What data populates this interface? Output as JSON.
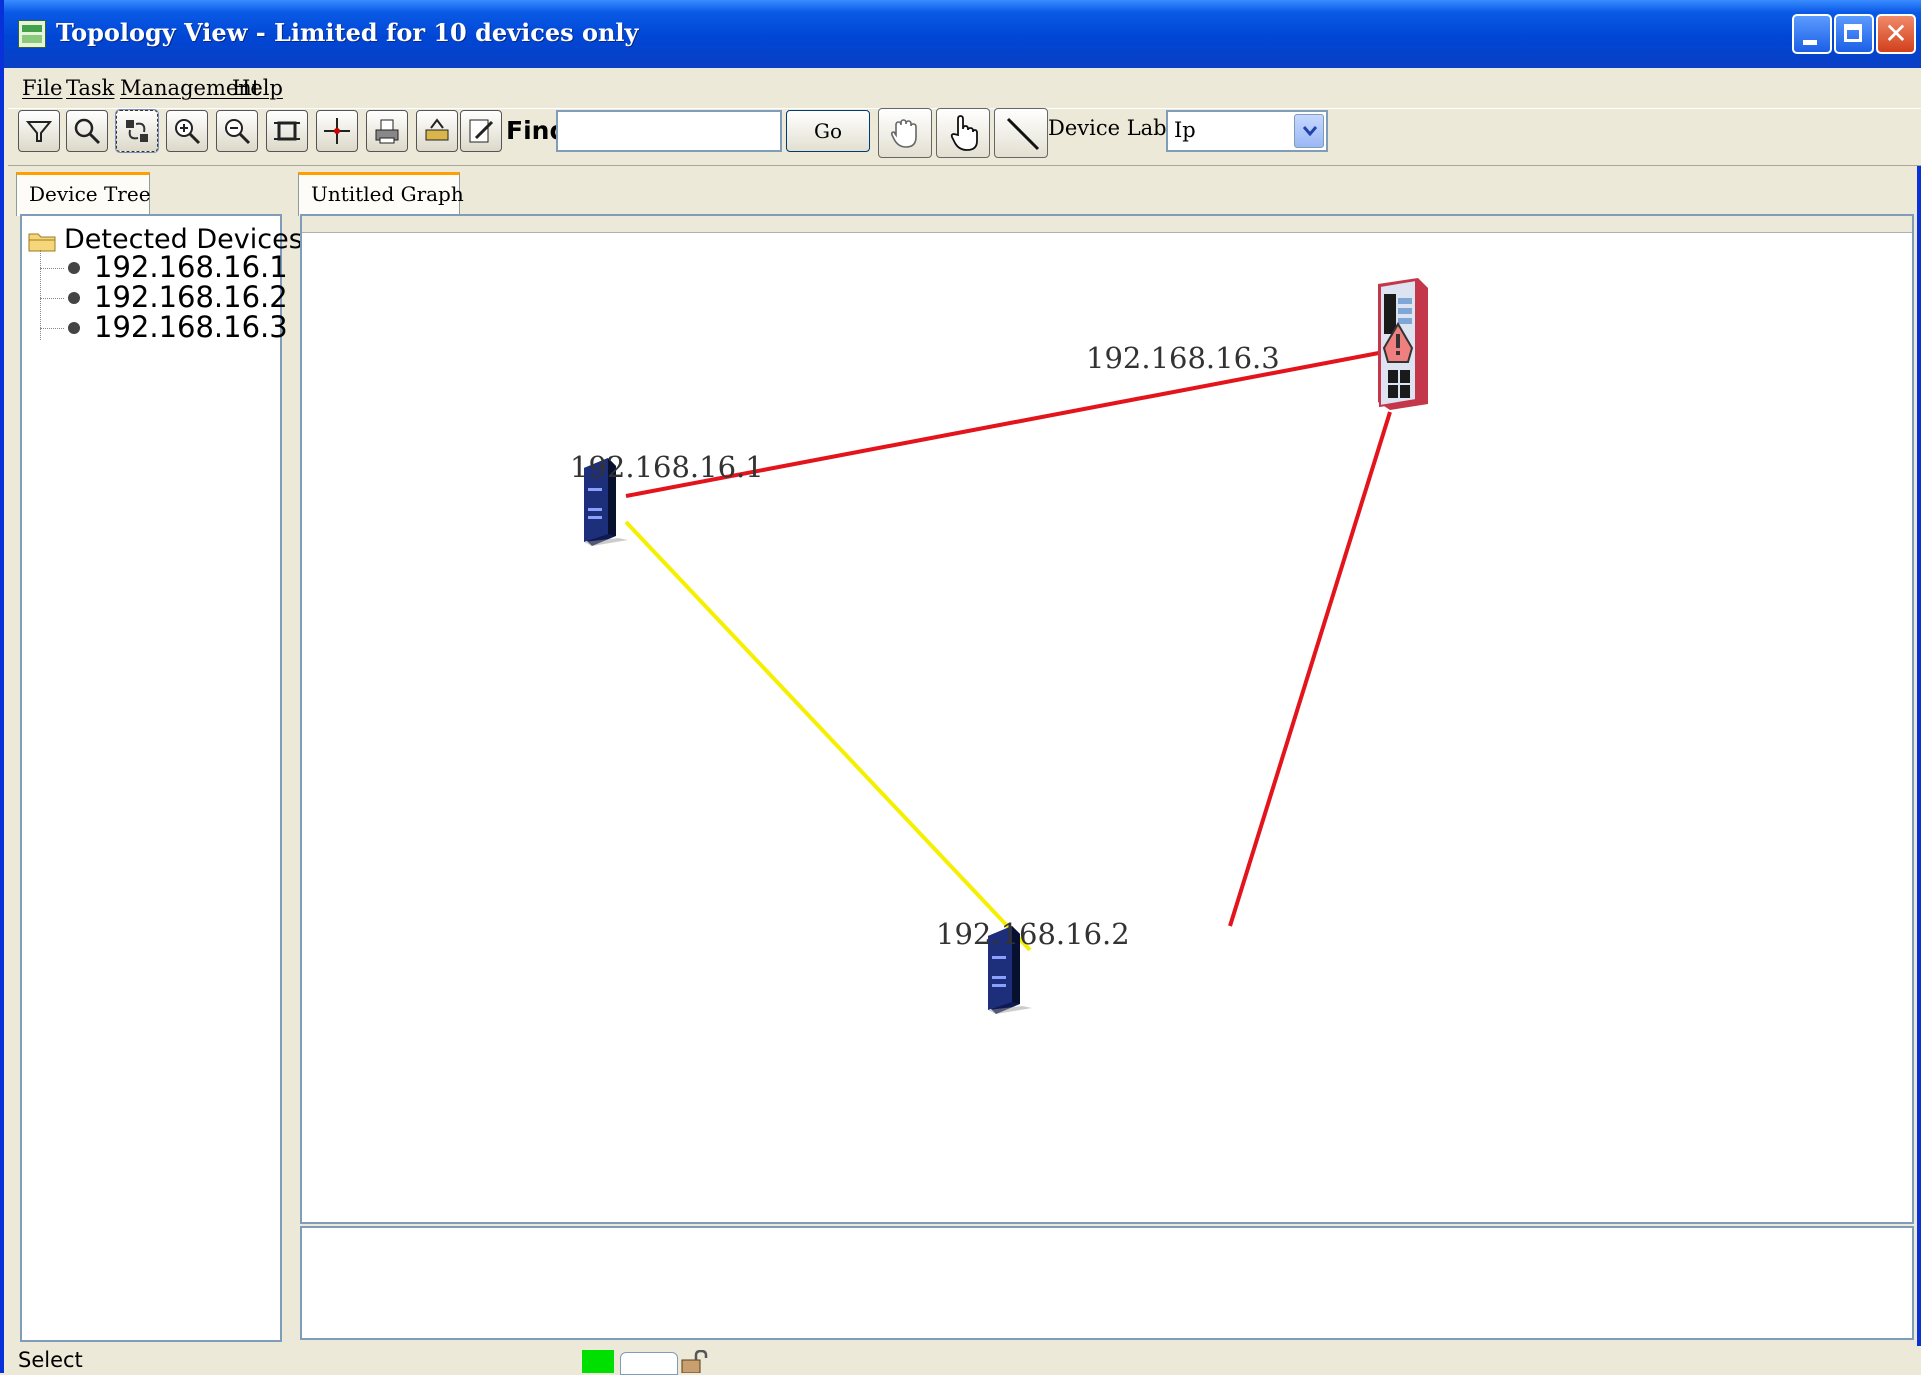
{
  "window": {
    "title": "Topology View  - Limited for 10 devices only",
    "icon": "topology-app-icon",
    "controls": [
      "minimize-icon",
      "maximize-icon",
      "close-icon"
    ]
  },
  "menu": {
    "items": [
      {
        "label": "File"
      },
      {
        "label": "Task"
      },
      {
        "label": "Management"
      },
      {
        "label": "Help"
      }
    ]
  },
  "toolbar": {
    "tools": [
      "filter-icon",
      "search-icon",
      "auto-layout-icon",
      "zoom-in-icon",
      "zoom-out-icon",
      "fit-to-window-icon",
      "center-icon",
      "print-icon",
      "export-icon",
      "edit-icon"
    ],
    "find_label": "Find",
    "find_value": "",
    "go_label": "Go",
    "modes": [
      "pan-hand-icon",
      "select-hand-icon",
      "link-line-icon"
    ],
    "device_label_text": "Device Label",
    "device_label_value": "Ip"
  },
  "left_panel": {
    "tab_label": "Device Tree",
    "root_label": "Detected Devices",
    "root_icon": "folder-icon",
    "devices": [
      "192.168.16.1",
      "192.168.16.2",
      "192.168.16.3"
    ]
  },
  "graph": {
    "tab_label": "Untitled Graph",
    "nodes": [
      {
        "label": "192.168.16.1",
        "icon": "switch-icon"
      },
      {
        "label": "192.168.16.2",
        "icon": "switch-icon"
      },
      {
        "label": "192.168.16.3",
        "icon": "managed-switch-alert-icon"
      }
    ],
    "links": [
      {
        "from": "192.168.16.1",
        "to": "192.168.16.3",
        "color": "#e3141b"
      },
      {
        "from": "192.168.16.3",
        "to": "192.168.16.2",
        "color": "#e3141b"
      },
      {
        "from": "192.168.16.1",
        "to": "192.168.16.2",
        "color": "#f5f000"
      }
    ]
  },
  "status": {
    "text": "Select",
    "indicator_color": "#00e000",
    "lock_icon": "lock-icon"
  },
  "colors": {
    "titlebar": "#0a50dd",
    "tab_accent": "#ff9f00",
    "link_down": "#e3141b",
    "link_warning": "#f5f000"
  }
}
